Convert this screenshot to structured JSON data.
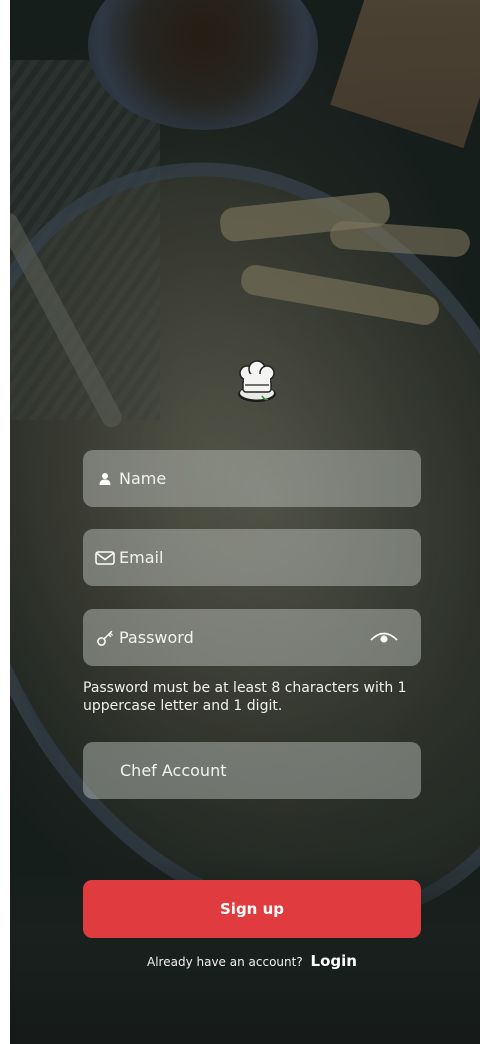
{
  "signup_form": {
    "name_placeholder": "Name",
    "email_placeholder": "Email",
    "password_placeholder": "Password",
    "password_hint": "Password must be at least 8 characters with 1 uppercase letter and 1 digit.",
    "account_type": "Chef Account",
    "signup_label": "Sign up"
  },
  "footer": {
    "prompt": "Already have an account?",
    "login_label": "Login"
  },
  "icons": {
    "logo": "chef-hat-logo-icon",
    "name": "user-icon",
    "email": "envelope-icon",
    "password": "key-icon",
    "visibility": "eye-icon"
  },
  "colors": {
    "primary_button": "#e03b3f",
    "field_background": "rgba(210,214,210,0.42)",
    "text": "#f2f2f0"
  }
}
